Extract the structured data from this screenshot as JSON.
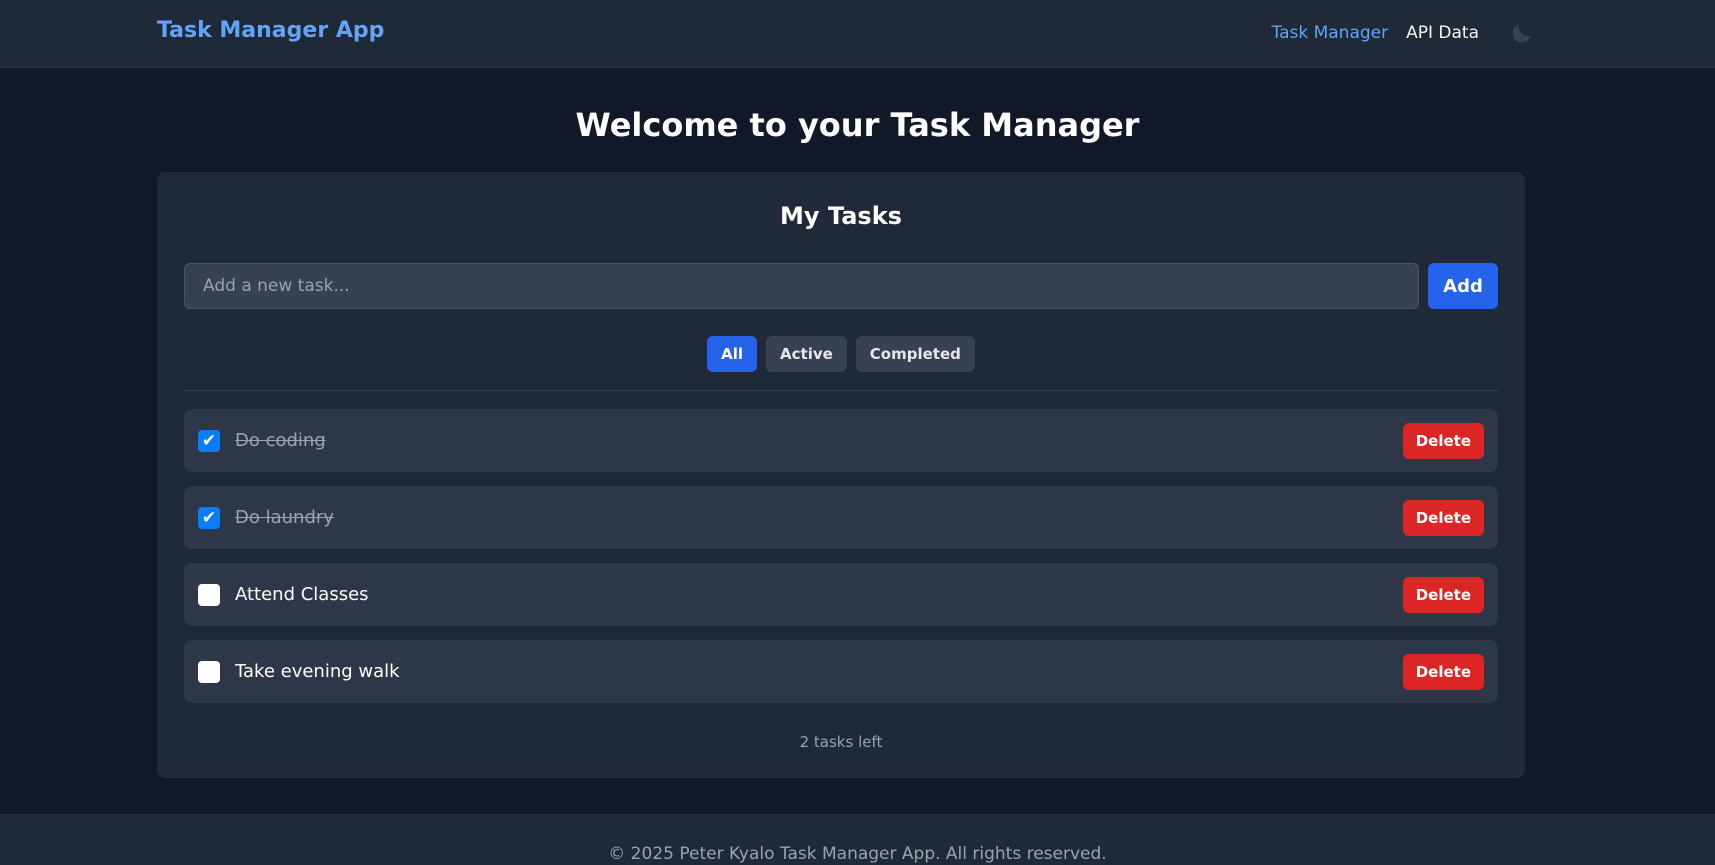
{
  "header": {
    "brand": "Task Manager App",
    "nav": [
      "Task Manager",
      "API Data"
    ],
    "theme_icon": "moon-icon"
  },
  "main": {
    "title": "Welcome to your Task Manager"
  },
  "card": {
    "title": "My Tasks",
    "input_placeholder": "Add a new task...",
    "add_label": "Add",
    "filters": [
      {
        "label": "All",
        "active": true
      },
      {
        "label": "Active",
        "active": false
      },
      {
        "label": "Completed",
        "active": false
      }
    ],
    "tasks": [
      {
        "text": "Do coding",
        "done": true
      },
      {
        "text": "Do laundry",
        "done": true
      },
      {
        "text": "Attend Classes",
        "done": false
      },
      {
        "text": "Take evening walk",
        "done": false
      }
    ],
    "delete_label": "Delete",
    "tasks_left": "2 tasks left"
  },
  "footer": {
    "text": "© 2025 Peter Kyalo Task Manager App. All rights reserved."
  },
  "colors": {
    "accent": "#2563eb",
    "danger": "#dc2626",
    "link": "#60a5fa"
  }
}
